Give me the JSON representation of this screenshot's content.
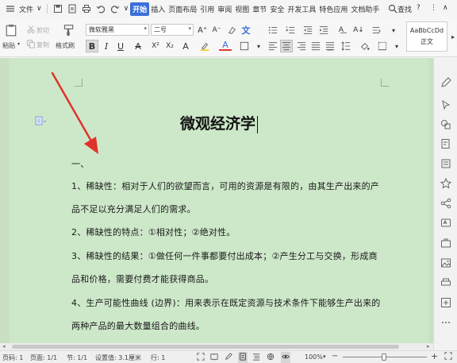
{
  "menubar": {
    "file": "文件",
    "file_caret": "∨",
    "tabs": [
      "开始",
      "插入",
      "页面布局",
      "引用",
      "审阅",
      "视图",
      "章节",
      "安全",
      "开发工具",
      "特色应用",
      "文档助手"
    ],
    "active_tab": "开始",
    "search": "查找",
    "help": "?",
    "more": "⋮",
    "collapse": "∧"
  },
  "ribbon": {
    "paste": "粘贴",
    "cut": "剪切",
    "copy": "复制",
    "format_painter": "格式刷",
    "font_name": "微软雅黑",
    "font_size": "二号",
    "style_sample": "AaBbCcDd",
    "style_name": "正文"
  },
  "document": {
    "title": "微观经济学",
    "paragraphs": [
      "一、",
      "1、稀缺性：相对于人们的欲望而言，可用的资源是有限的，由其生产出来的产",
      "品不足以充分满足人们的需求。",
      "2、稀缺性的特点：①相对性；②绝对性。",
      "3、稀缺性的结果：①做任何一件事都要付出成本；②产生分工与交换，形成商",
      "品和价格，需要付费才能获得商品。",
      "4、生产可能性曲线 (边界)：用来表示在既定资源与技术条件下能够生产出来的",
      "两种产品的最大数量组合的曲线。"
    ]
  },
  "statusbar": {
    "page_num": "页码: 1",
    "page": "页面: 1/1",
    "section": "节: 1/1",
    "setting": "设置值: 3.1厘米",
    "row": "行: 1",
    "zoom": "100%",
    "zoom_minus": "−",
    "zoom_plus": "+"
  },
  "colors": {
    "page_bg": "#cde8c9",
    "workspace_bg": "#c9e0c5",
    "accent": "#3a6fd8",
    "arrow": "#e0332b"
  }
}
